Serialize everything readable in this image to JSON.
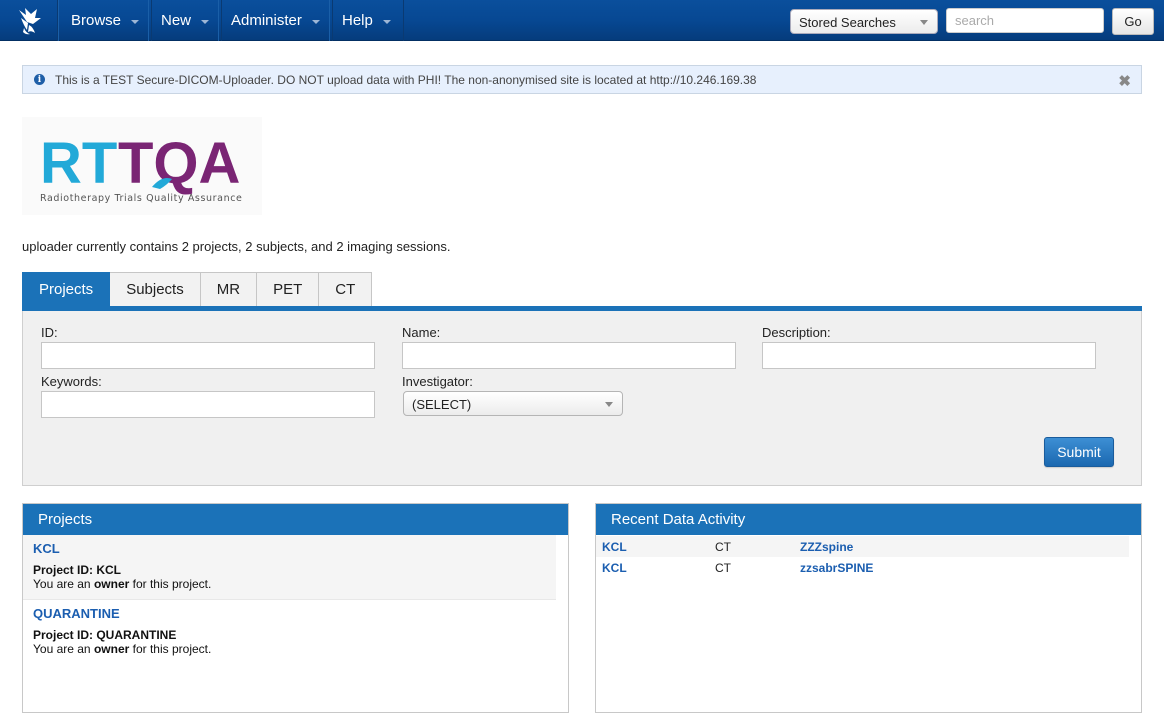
{
  "nav": {
    "logo_icon": "xnat-logo-icon",
    "items": [
      {
        "label": "Browse"
      },
      {
        "label": "New"
      },
      {
        "label": "Administer"
      },
      {
        "label": "Help"
      }
    ],
    "stored_searches": "Stored Searches",
    "search_placeholder": "search",
    "search_value": "",
    "go_label": "Go"
  },
  "alert": {
    "icon": "info-icon",
    "text": "This is a TEST Secure-DICOM-Uploader. DO NOT upload data with PHI! The non-anonymised site is located at http://10.246.169.38",
    "close_glyph": "✖"
  },
  "brand": {
    "logo_part1": "RT",
    "logo_part2": "TQA",
    "tagline": "Radiotherapy Trials Quality Assurance",
    "color_primary": "#22a9d8",
    "color_secondary": "#7a2574"
  },
  "summary": "uploader currently contains 2 projects, 2 subjects, and 2 imaging sessions.",
  "tabs": [
    {
      "label": "Projects",
      "active": true
    },
    {
      "label": "Subjects",
      "active": false
    },
    {
      "label": "MR",
      "active": false
    },
    {
      "label": "PET",
      "active": false
    },
    {
      "label": "CT",
      "active": false
    }
  ],
  "search_form": {
    "id_label": "ID:",
    "id_value": "",
    "name_label": "Name:",
    "name_value": "",
    "description_label": "Description:",
    "description_value": "",
    "keywords_label": "Keywords:",
    "keywords_value": "",
    "investigator_label": "Investigator:",
    "investigator_value": "(SELECT)",
    "submit_label": "Submit"
  },
  "projects_box": {
    "title": "Projects",
    "items": [
      {
        "name": "KCL",
        "id_line": "Project ID: KCL",
        "role_prefix": "You are an ",
        "role": "owner",
        "role_suffix": " for this project."
      },
      {
        "name": "QUARANTINE",
        "id_line": "Project ID: QUARANTINE",
        "role_prefix": "You are an ",
        "role": "owner",
        "role_suffix": " for this project."
      }
    ]
  },
  "activity_box": {
    "title": "Recent Data Activity",
    "rows": [
      {
        "project": "KCL",
        "modality": "CT",
        "session": "ZZZspine"
      },
      {
        "project": "KCL",
        "modality": "CT",
        "session": "zzsabrSPINE"
      }
    ]
  }
}
